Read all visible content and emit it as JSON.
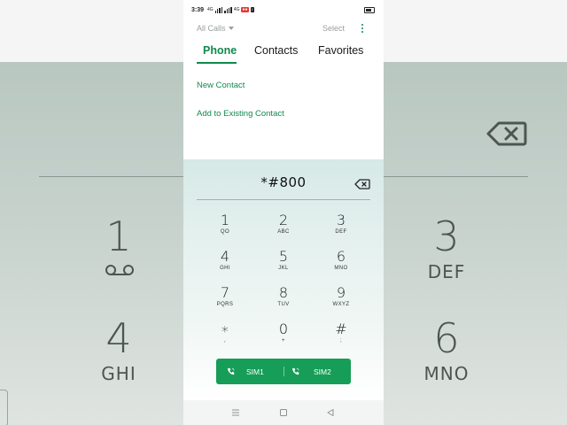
{
  "status_bar": {
    "time": "3:39",
    "network_left": "4G",
    "network_right": "4G"
  },
  "toolbar": {
    "filter_label": "All Calls",
    "select_label": "Select"
  },
  "tabs": [
    {
      "label": "Phone",
      "active": true
    },
    {
      "label": "Contacts",
      "active": false
    },
    {
      "label": "Favorites",
      "active": false
    }
  ],
  "actions": {
    "new_contact": "New Contact",
    "add_existing": "Add to Existing Contact"
  },
  "dialer": {
    "number": "*#800",
    "keys": [
      {
        "digit": "1",
        "letters": "QO"
      },
      {
        "digit": "2",
        "letters": "ABC"
      },
      {
        "digit": "3",
        "letters": "DEF"
      },
      {
        "digit": "4",
        "letters": "GHI"
      },
      {
        "digit": "5",
        "letters": "JKL"
      },
      {
        "digit": "6",
        "letters": "MNO"
      },
      {
        "digit": "7",
        "letters": "PQRS"
      },
      {
        "digit": "8",
        "letters": "TUV"
      },
      {
        "digit": "9",
        "letters": "WXYZ"
      },
      {
        "digit": "∗",
        "letters": ","
      },
      {
        "digit": "0",
        "letters": "+"
      },
      {
        "digit": "#",
        "letters": ";"
      }
    ],
    "sim1_label": "SIM1",
    "sim2_label": "SIM2"
  },
  "background_zoom": {
    "digit_1": "1",
    "digit_3": "3",
    "letters_3": "DEF",
    "digit_4": "4",
    "letters_4": "GHI",
    "digit_6": "6",
    "letters_6": "MNO"
  },
  "colors": {
    "accent": "#11894d",
    "sim_bar": "#169d57",
    "dialer_top": "#d6e9e6"
  },
  "icons": {
    "more": "more-vertical-icon",
    "backspace": "backspace-icon",
    "call": "phone-call-icon",
    "voicemail": "voicemail-icon"
  }
}
